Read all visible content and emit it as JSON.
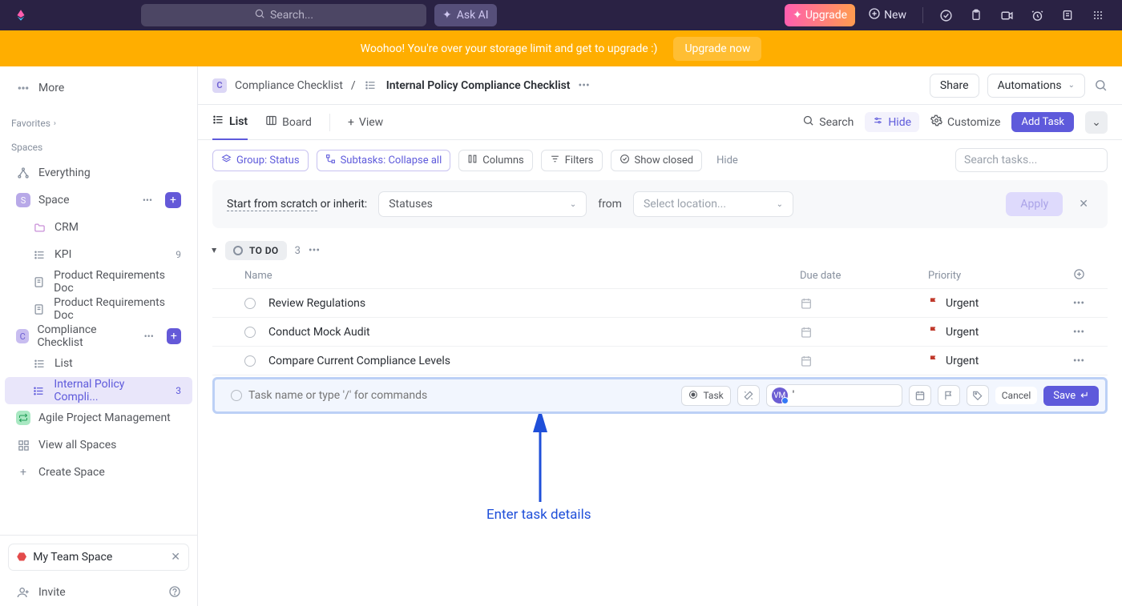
{
  "topbar": {
    "search_placeholder": "Search...",
    "ask_ai": "Ask AI",
    "upgrade": "Upgrade",
    "new": "New"
  },
  "banner": {
    "message": "Woohoo! You're over your storage limit and get to upgrade :)",
    "button": "Upgrade now"
  },
  "sidebar": {
    "more": "More",
    "favorites": "Favorites",
    "spaces": "Spaces",
    "items": {
      "everything": "Everything",
      "space": "Space",
      "crm": "CRM",
      "kpi": "KPI",
      "kpi_count": "9",
      "prd1": "Product Requirements Doc",
      "prd2": "Product Requirements Doc",
      "compliance": "Compliance Checklist",
      "list": "List",
      "internal": "Internal Policy Compli...",
      "internal_count": "3",
      "agile": "Agile Project Management",
      "viewall": "View all Spaces",
      "create": "Create Space"
    },
    "team": "My Team Space",
    "invite": "Invite"
  },
  "breadcrumb": {
    "space": "Compliance Checklist",
    "page": "Internal Policy Compliance Checklist",
    "share": "Share",
    "automations": "Automations"
  },
  "views": {
    "list": "List",
    "board": "Board",
    "view": "View",
    "search": "Search",
    "hide": "Hide",
    "customize": "Customize",
    "add_task": "Add Task"
  },
  "filters": {
    "group": "Group: Status",
    "subtasks": "Subtasks: Collapse all",
    "columns": "Columns",
    "filters": "Filters",
    "show_closed": "Show closed",
    "hide": "Hide",
    "search_placeholder": "Search tasks..."
  },
  "inherit": {
    "start": "Start from scratch",
    "or_inherit": " or inherit:",
    "statuses": "Statuses",
    "from": "from",
    "select_location": "Select location...",
    "apply": "Apply"
  },
  "group": {
    "status": "TO DO",
    "count": "3"
  },
  "columns": {
    "name": "Name",
    "due": "Due date",
    "priority": "Priority"
  },
  "tasks": [
    {
      "name": "Review Regulations",
      "priority": "Urgent"
    },
    {
      "name": "Conduct Mock Audit",
      "priority": "Urgent"
    },
    {
      "name": "Compare Current Compliance Levels",
      "priority": "Urgent"
    }
  ],
  "newtask": {
    "placeholder": "Task name or type '/' for commands",
    "task_label": "Task",
    "assignee_text": "'",
    "cancel": "Cancel",
    "save": "Save"
  },
  "annotation": {
    "label": "Enter task details"
  }
}
